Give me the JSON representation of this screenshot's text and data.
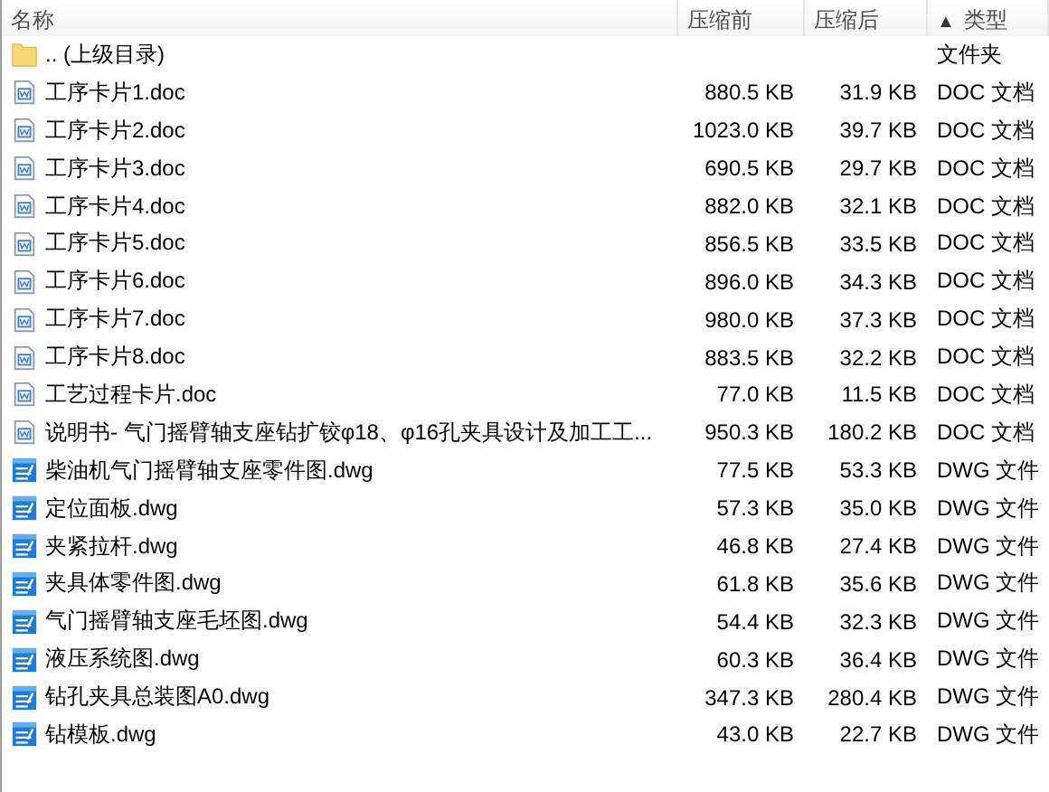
{
  "columns": [
    {
      "label": "名称"
    },
    {
      "label": "压缩前"
    },
    {
      "label": "压缩后"
    },
    {
      "label": "类型",
      "sort_mark": "▲"
    }
  ],
  "rows": [
    {
      "kind": "folder",
      "name": ".. (上级目录)",
      "type": "文件夹"
    },
    {
      "kind": "doc",
      "name": "工序卡片1.doc",
      "size_before": "880.5 KB",
      "size_after": "31.9 KB",
      "type": "DOC 文档"
    },
    {
      "kind": "doc",
      "name": "工序卡片2.doc",
      "size_before": "1023.0 KB",
      "size_after": "39.7 KB",
      "type": "DOC 文档"
    },
    {
      "kind": "doc",
      "name": "工序卡片3.doc",
      "size_before": "690.5 KB",
      "size_after": "29.7 KB",
      "type": "DOC 文档"
    },
    {
      "kind": "doc",
      "name": "工序卡片4.doc",
      "size_before": "882.0 KB",
      "size_after": "32.1 KB",
      "type": "DOC 文档"
    },
    {
      "kind": "doc",
      "name": "工序卡片5.doc",
      "size_before": "856.5 KB",
      "size_after": "33.5 KB",
      "type": "DOC 文档"
    },
    {
      "kind": "doc",
      "name": "工序卡片6.doc",
      "size_before": "896.0 KB",
      "size_after": "34.3 KB",
      "type": "DOC 文档"
    },
    {
      "kind": "doc",
      "name": "工序卡片7.doc",
      "size_before": "980.0 KB",
      "size_after": "37.3 KB",
      "type": "DOC 文档"
    },
    {
      "kind": "doc",
      "name": "工序卡片8.doc",
      "size_before": "883.5 KB",
      "size_after": "32.2 KB",
      "type": "DOC 文档"
    },
    {
      "kind": "doc",
      "name": "工艺过程卡片.doc",
      "size_before": "77.0 KB",
      "size_after": "11.5 KB",
      "type": "DOC 文档"
    },
    {
      "kind": "doc",
      "name": "说明书- 气门摇臂轴支座钻扩铰φ18、φ16孔夹具设计及加工工...",
      "size_before": "950.3 KB",
      "size_after": "180.2 KB",
      "type": "DOC 文档"
    },
    {
      "kind": "dwg",
      "name": "柴油机气门摇臂轴支座零件图.dwg",
      "size_before": "77.5 KB",
      "size_after": "53.3 KB",
      "type": "DWG 文件"
    },
    {
      "kind": "dwg",
      "name": "定位面板.dwg",
      "size_before": "57.3 KB",
      "size_after": "35.0 KB",
      "type": "DWG 文件"
    },
    {
      "kind": "dwg",
      "name": "夹紧拉杆.dwg",
      "size_before": "46.8 KB",
      "size_after": "27.4 KB",
      "type": "DWG 文件"
    },
    {
      "kind": "dwg",
      "name": "夹具体零件图.dwg",
      "size_before": "61.8 KB",
      "size_after": "35.6 KB",
      "type": "DWG 文件"
    },
    {
      "kind": "dwg",
      "name": "气门摇臂轴支座毛坯图.dwg",
      "size_before": "54.4 KB",
      "size_after": "32.3 KB",
      "type": "DWG 文件"
    },
    {
      "kind": "dwg",
      "name": "液压系统图.dwg",
      "size_before": "60.3 KB",
      "size_after": "36.4 KB",
      "type": "DWG 文件"
    },
    {
      "kind": "dwg",
      "name": "钻孔夹具总装图A0.dwg",
      "size_before": "347.3 KB",
      "size_after": "280.4 KB",
      "type": "DWG 文件"
    },
    {
      "kind": "dwg",
      "name": "钻模板.dwg",
      "size_before": "43.0 KB",
      "size_after": "22.7 KB",
      "type": "DWG 文件"
    }
  ]
}
